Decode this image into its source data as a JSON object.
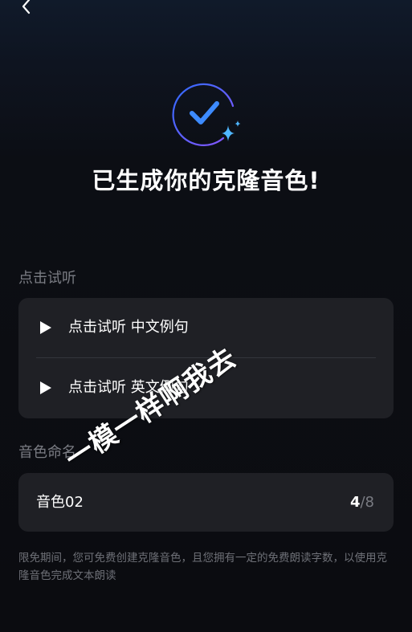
{
  "header": {
    "back_icon": "chevron-left-icon"
  },
  "hero": {
    "icon": "check-circle-sparkle-icon",
    "title": "已生成你的克隆音色!"
  },
  "listen_section": {
    "label": "点击试听",
    "items": [
      {
        "label": "点击试听 中文例句",
        "icon": "play-icon"
      },
      {
        "label": "点击试听 英文例句",
        "icon": "play-icon"
      }
    ]
  },
  "name_section": {
    "label": "音色命名",
    "input_value": "音色02",
    "counter_current": "4",
    "counter_sep": "/",
    "counter_max": "8"
  },
  "note": "限免期间，您可免费创建克隆音色，且您拥有一定的免费朗读字数，以使用克隆音色完成文本朗读",
  "watermark": "一模一样啊我去",
  "colors": {
    "accent_gradient_start": "#2f6bff",
    "accent_gradient_end": "#7c4dff",
    "check": "#3d8bff",
    "sparkle": "#4fb6ff",
    "card": "#1f2025"
  }
}
